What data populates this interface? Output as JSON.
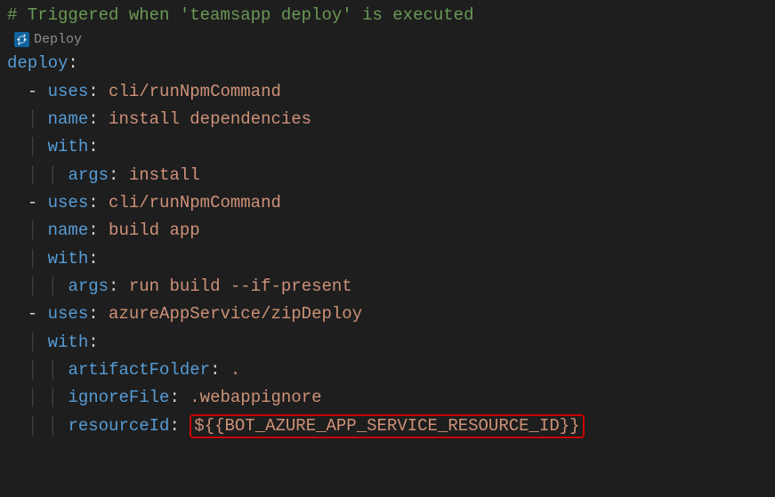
{
  "editor": {
    "comment": "# Triggered when 'teamsapp deploy' is executed",
    "codelens_label": "Deploy",
    "deploy_key": "deploy",
    "colon": ":",
    "dash": "-",
    "space": " ",
    "pipe": "│",
    "items": [
      {
        "uses_key": "uses",
        "uses_val": "cli/runNpmCommand",
        "name_key": "name",
        "name_val": "install dependencies",
        "with_key": "with",
        "args_key": "args",
        "args_val": "install"
      },
      {
        "uses_key": "uses",
        "uses_val": "cli/runNpmCommand",
        "name_key": "name",
        "name_val": "build app",
        "with_key": "with",
        "args_key": "args",
        "args_val": "run build --if-present"
      },
      {
        "uses_key": "uses",
        "uses_val": "azureAppService/zipDeploy",
        "with_key": "with",
        "artifact_key": "artifactFolder",
        "artifact_val": ".",
        "ignore_key": "ignoreFile",
        "ignore_val": ".webappignore",
        "resource_key": "resourceId",
        "resource_val": "${{BOT_AZURE_APP_SERVICE_RESOURCE_ID}}"
      }
    ]
  }
}
